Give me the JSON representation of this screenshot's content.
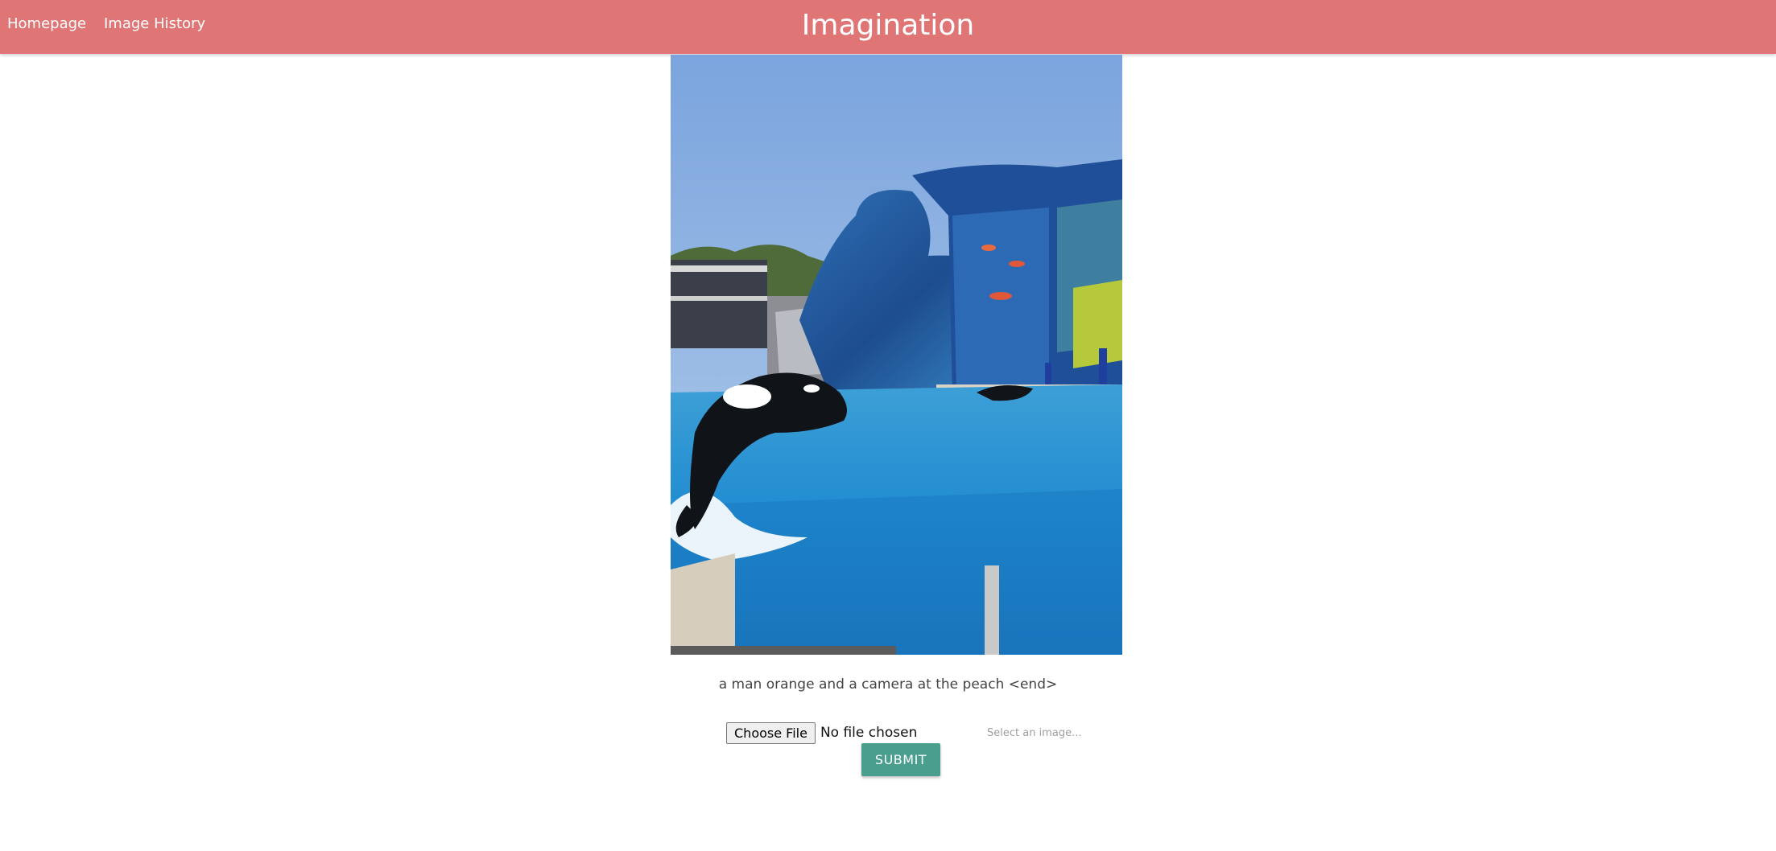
{
  "nav": {
    "home_label": "Homepage",
    "history_label": "Image History",
    "brand": "Imagination"
  },
  "main": {
    "image_alt": "orca whale jumping out of a blue pool at an aquarium show",
    "caption": "a man orange and a camera at the peach <end>"
  },
  "upload": {
    "choose_label": "Choose File",
    "file_status": "No file chosen",
    "path_placeholder": "Select an image...",
    "submit_label": "SUBMIT"
  },
  "colors": {
    "navbar": "#e07576",
    "submit": "#4a9e8e"
  }
}
